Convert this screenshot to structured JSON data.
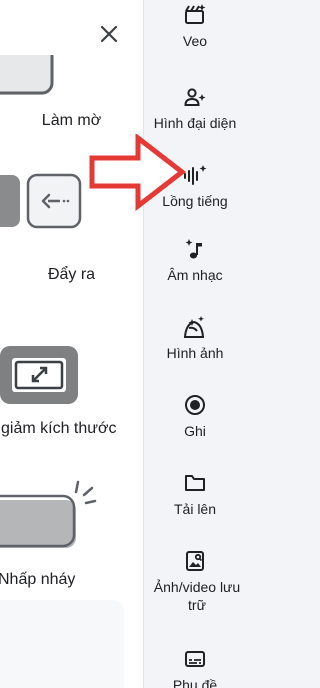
{
  "effects_panel": {
    "items": [
      {
        "label": "Làm mờ"
      },
      {
        "label": "Đẩy ra"
      },
      {
        "label": "giảm kích thước"
      },
      {
        "label": "Nhấp nháy"
      }
    ]
  },
  "tool_rail": {
    "items": [
      {
        "label": "Veo",
        "icon": "video-sparkle-icon"
      },
      {
        "label": "Hình đại diện",
        "icon": "avatar-sparkle-icon"
      },
      {
        "label": "Lồng tiếng",
        "icon": "voiceover-icon"
      },
      {
        "label": "Âm nhạc",
        "icon": "music-note-sparkle-icon"
      },
      {
        "label": "Hình ảnh",
        "icon": "image-sparkle-icon"
      },
      {
        "label": "Ghi",
        "icon": "record-icon"
      },
      {
        "label": "Tải lên",
        "icon": "folder-icon"
      },
      {
        "label": "Ảnh/video lưu trữ",
        "icon": "stock-media-icon"
      },
      {
        "label": "Phụ đề",
        "icon": "subtitles-icon"
      }
    ]
  },
  "annotation": {
    "color": "#e53935"
  }
}
